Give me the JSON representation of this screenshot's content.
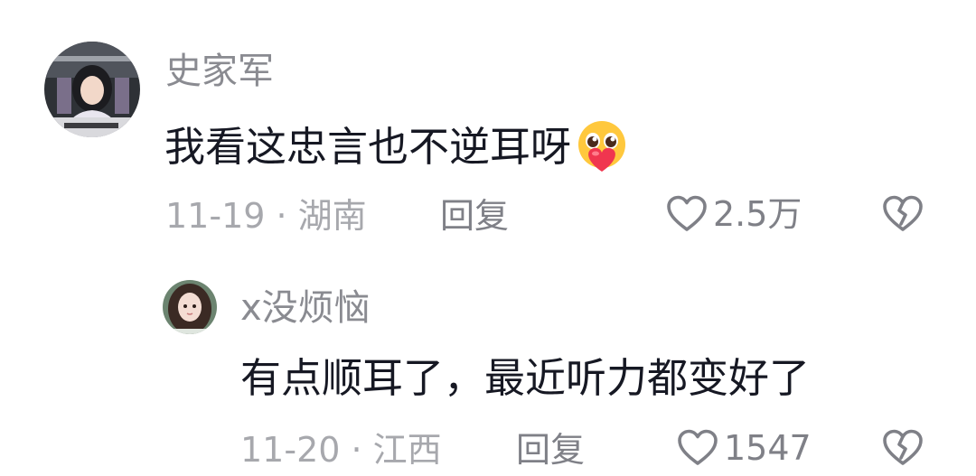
{
  "comments": [
    {
      "username": "史家军",
      "text": "我看这忠言也不逆耳呀",
      "emoji": "pleading-heart-emoji",
      "meta": "11-19 · 湖南",
      "reply_label": "回复",
      "likes": "2.5万"
    },
    {
      "username": "x没烦恼",
      "text": "有点顺耳了，最近听力都变好了",
      "meta": "11-20 · 江西",
      "reply_label": "回复",
      "likes": "1547"
    }
  ],
  "icons": {
    "like": "heart-outline-icon",
    "dislike": "broken-heart-icon"
  },
  "colors": {
    "text_primary": "#161823",
    "text_secondary": "#8a8b91",
    "text_meta": "#a7a8ad",
    "emoji_heart": "#f0364f",
    "emoji_face": "#ffc83d"
  }
}
